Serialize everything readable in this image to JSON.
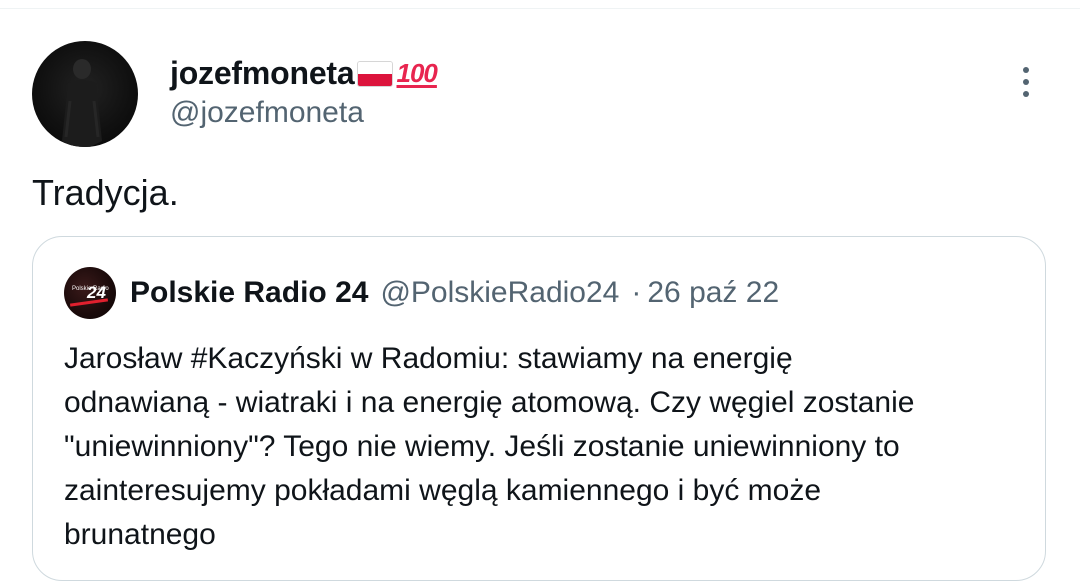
{
  "tweet": {
    "display_name": "jozefmoneta",
    "name_emojis": [
      "flag-poland-icon",
      "hundred-points-icon"
    ],
    "hundred_glyph": "100",
    "handle": "@jozefmoneta",
    "text": "Tradycja."
  },
  "quoted_tweet": {
    "display_name": "Polskie Radio 24",
    "handle": "@PolskieRadio24",
    "separator": "·",
    "date": "26 paź 22",
    "avatar_label": "Polskie Radio",
    "avatar_number": "24",
    "body_lines": [
      "Jarosław #Kaczyński w Radomiu: stawiamy na energię",
      "odnawianą - wiatraki i na energię atomową. Czy węgiel zostanie",
      "\"uniewinniony\"? Tego nie wiemy. Jeśli zostanie uniewinniony to",
      "zainteresujemy pokładami węglą kamiennego i być może",
      "brunatnego"
    ]
  },
  "colors": {
    "text_primary": "#0f1419",
    "text_secondary": "#536471",
    "border": "#cfd9de",
    "accent_red": "#e8254f",
    "flag_red": "#dc143c"
  },
  "icons": {
    "more": "more-dots-vertical-icon"
  }
}
